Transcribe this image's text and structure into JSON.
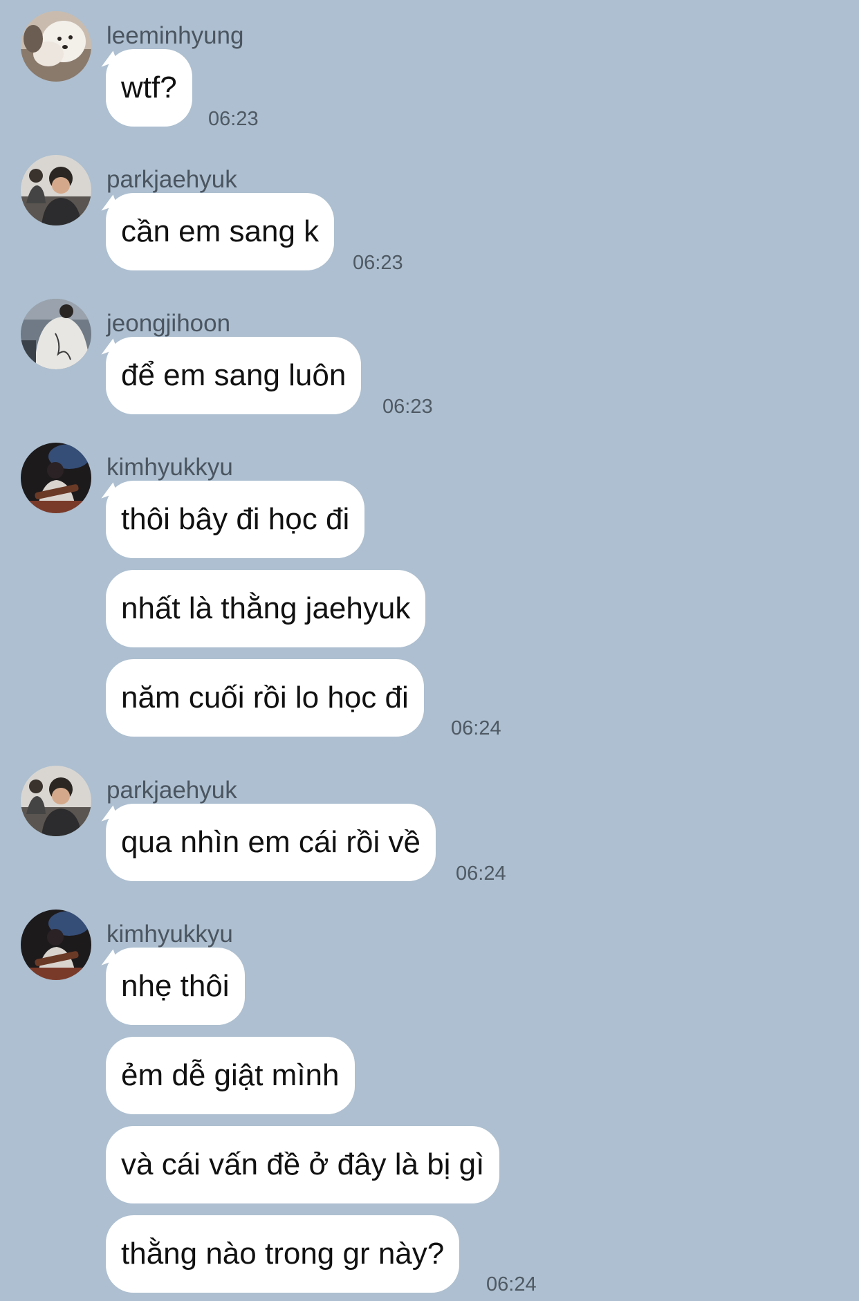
{
  "colors": {
    "background": "#adbfd0",
    "bubble": "#ffffff",
    "sender_text": "#4b5560",
    "time_text": "#4f5963"
  },
  "messages": [
    {
      "sender": "leeminhyung",
      "avatar_icon": "dog-avatar-icon",
      "bubbles": [
        "wtf?"
      ],
      "time": "06:23"
    },
    {
      "sender": "parkjaehyuk",
      "avatar_icon": "person-eating-avatar-icon",
      "bubbles": [
        "cần em sang k"
      ],
      "time": "06:23"
    },
    {
      "sender": "jeongjihoon",
      "avatar_icon": "person-white-shirt-avatar-icon",
      "bubbles": [
        "để em sang luôn"
      ],
      "time": "06:23"
    },
    {
      "sender": "kimhyukkyu",
      "avatar_icon": "guitar-player-avatar-icon",
      "bubbles": [
        "thôi bây đi học đi",
        "nhất là thằng jaehyuk",
        "năm cuối rồi lo học đi"
      ],
      "time": "06:24"
    },
    {
      "sender": "parkjaehyuk",
      "avatar_icon": "person-eating-avatar-icon",
      "bubbles": [
        "qua nhìn em cái rồi về"
      ],
      "time": "06:24"
    },
    {
      "sender": "kimhyukkyu",
      "avatar_icon": "guitar-player-avatar-icon",
      "bubbles": [
        "nhẹ thôi",
        "ẻm dễ giật mình",
        "và cái vấn đề ở đây là bị gì",
        "thằng nào trong gr này?"
      ],
      "time": "06:24"
    }
  ]
}
